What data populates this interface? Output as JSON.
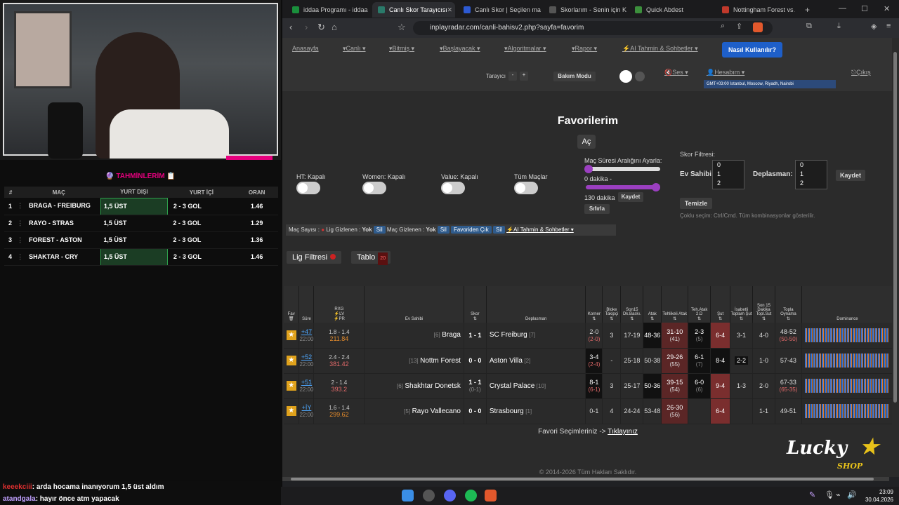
{
  "stream": {
    "predictions_title": "🔮 TAHMİNLERİM 📋",
    "columns": [
      "#",
      "MAÇ",
      "YURT DIŞI",
      "YURT İÇİ",
      "ORAN"
    ],
    "rows": [
      {
        "n": "1",
        "match": "BRAGA - FREIBURG",
        "yurt_disi": "1,5 ÜST",
        "yurt_ici": "2 - 3 GOL",
        "oran": "1.46",
        "highlight": true
      },
      {
        "n": "2",
        "match": "RAYO - STRAS",
        "yurt_disi": "1,5 ÜST",
        "yurt_ici": "2 - 3 GOL",
        "oran": "1.29",
        "highlight": false
      },
      {
        "n": "3",
        "match": "FOREST - ASTON",
        "yurt_disi": "1,5 ÜST",
        "yurt_ici": "2 - 3 GOL",
        "oran": "1.36",
        "highlight": false
      },
      {
        "n": "4",
        "match": "SHAKTAR - CRY",
        "yurt_disi": "1,5 ÜST",
        "yurt_ici": "2 - 3 GOL",
        "oran": "1.46",
        "highlight": true
      }
    ],
    "chat": [
      {
        "user": "keeekciii",
        "msg": ": arda hocama inanıyorum 1,5 üst aldım"
      },
      {
        "user": "atandgala",
        "msg": ": hayır önce atm yapacak"
      }
    ]
  },
  "browser": {
    "tabs": [
      {
        "label": "iddaa Programı - iddaa B",
        "color": "#1a8f3c"
      },
      {
        "label": "Canlı Skor Tarayıcısı",
        "color": "#2a7a6a",
        "active": true
      },
      {
        "label": "Canlı Skor | Seçilen maçl",
        "color": "#2d5ad3"
      },
      {
        "label": "Skorlarım - Senin için Kişi",
        "color": "#222"
      },
      {
        "label": "Quick Abdest",
        "color": "#3c8f3c"
      },
      {
        "label": "Nottingham Forest vs Ast",
        "color": "#c0392b"
      }
    ],
    "url": "inplayradar.com/canli-bahisv2.php?sayfa=favorim"
  },
  "menu": {
    "items": [
      "Anasayfa",
      "▾Canlı ▾",
      "▾Bitmiş ▾",
      "▾Başlayacak ▾",
      "▾Algoritmalar ▾",
      "▾Rapor ▾",
      "⚡AI Tahmin & Sohbetler ▾"
    ],
    "how_button": "Nasıl Kullanılır?",
    "tarayici_label": "Tarayıcı",
    "minus": "-",
    "plus": "+",
    "bakim": "Bakım Modu",
    "ses": "🔇Ses ▾",
    "hesabim": "👤Hesabım ▾",
    "cikis": "⎋Çıkış",
    "timezone": "GMT+03:00 Istanbul, Moscow, Riyadh, Nairobi"
  },
  "filters": {
    "page_title": "Favorilerim",
    "ac_button": "Aç",
    "ht": "HT: Kapalı",
    "women": "Women: Kapalı",
    "value": "Value: Kapalı",
    "tum": "Tüm Maçlar",
    "sure_label": "Maç Süresi Aralığını Ayarla:",
    "min_label": "0 dakika -",
    "max_label": "130 dakika",
    "kaydet": "Kaydet",
    "sifirla": "Sıfırla",
    "skor_filtresi": "Skor Filtresi:",
    "ev_sahibi": "Ev Sahibi:",
    "deplasman": "Deplasman:",
    "score_opts": [
      "0",
      "1",
      "2"
    ],
    "temizle": "Temizle",
    "coklu": "Çoklu seçim: Ctrl/Cmd. Tüm kombinasyonlar gösterilir.",
    "info_mac_sayisi": "Maç Sayısı :",
    "info_lig_gizlenen": "Lig Gizlenen :",
    "info_yok": "Yok",
    "info_sil": "Sil",
    "info_mac_gizlenen": "Maç Gizlenen :",
    "info_favoriden": "Favoriden Çık",
    "info_ai": "⚡AI Tahmin & Sohbetler ▾",
    "lig_filtresi": "Lig Filtresi",
    "tablo": "Tablo",
    "tablo_count": "20"
  },
  "table": {
    "headers": [
      "Fav",
      "Süre",
      "RXG",
      "Ev Sahibi",
      "Skor",
      "Deplasman",
      "Korner",
      "Bloke Takipçi",
      "Son15 Dk.Baskı.",
      "Atak",
      "Tehlikeli Atak",
      "Teh.Atak 2.D",
      "Şut",
      "İsabetli Toplam Şut",
      "Son 15 Dakika Topl.Sut",
      "Topla Oynama",
      "Dominance"
    ],
    "rows": [
      {
        "min": "+47",
        "time": "22:00",
        "rxg": "1.8 - 1.4",
        "val": "211.84",
        "home": "Braga",
        "home_rank": "[6]",
        "score": "1 - 1",
        "ht": "",
        "away": "SC Freiburg",
        "away_rank": "[7]",
        "korner": "2-0",
        "korner2": "(2-0)",
        "bloke": "3",
        "son15": "17-19",
        "atak": "48-36",
        "teh": "31-10",
        "teh2": "(41)",
        "teh2d": "2-3",
        "teh2d2": "(5)",
        "sut": "6-4",
        "isabet": "3-1",
        "son15sut": "4-0",
        "topla": "48-52",
        "topla2": "(50-50)"
      },
      {
        "min": "+52",
        "time": "22:00",
        "rxg": "2.4 - 2.4",
        "val": "381.42",
        "home": "Nottm Forest",
        "home_rank": "[13]",
        "score": "0 - 0",
        "ht": "",
        "away": "Aston Villa",
        "away_rank": "[2]",
        "korner": "3-4",
        "korner2": "(2-4)",
        "bloke": "-",
        "son15": "25-18",
        "atak": "50-38",
        "teh": "29-26",
        "teh2": "(55)",
        "teh2d": "6-1",
        "teh2d2": "(7)",
        "sut": "8-4",
        "isabet": "2-2",
        "son15sut": "1-0",
        "topla": "57-43",
        "topla2": ""
      },
      {
        "min": "+51",
        "time": "22:00",
        "rxg": "2 - 1.4",
        "val": "393.2",
        "home": "Shakhtar Donetsk",
        "home_rank": "[6]",
        "score": "1 - 1",
        "ht": "(0-1)",
        "away": "Crystal Palace",
        "away_rank": "[10]",
        "korner": "8-1",
        "korner2": "(6-1)",
        "bloke": "3",
        "son15": "25-17",
        "atak": "50-36",
        "teh": "39-15",
        "teh2": "(54)",
        "teh2d": "6-0",
        "teh2d2": "(6)",
        "sut": "9-4",
        "isabet": "1-3",
        "son15sut": "2-0",
        "topla": "67-33",
        "topla2": "(65-35)"
      },
      {
        "min": "+İY",
        "time": "22:00",
        "rxg": "1.6 - 1.4",
        "val": "299.62",
        "home": "Rayo Vallecano",
        "home_rank": "[5]",
        "score": "0 - 0",
        "ht": "",
        "away": "Strasbourg",
        "away_rank": "[1]",
        "korner": "0-1",
        "korner2": "",
        "bloke": "4",
        "son15": "24-24",
        "atak": "53-48",
        "teh": "26-30",
        "teh2": "(56)",
        "teh2d": "",
        "teh2d2": "",
        "sut": "6-4",
        "isabet": "",
        "son15sut": "1-1",
        "topla": "49-51",
        "topla2": ""
      }
    ],
    "footer_text": "Favori Seçimleriniz -> ",
    "footer_link": "Tıklayınız",
    "copyright": "© 2014-2026 Tüm Hakları Saklıdır."
  },
  "overlay": {
    "brand": "Lucky",
    "shop": "SHOP"
  },
  "clock": {
    "time": "23:09",
    "date": "30.04.2026"
  }
}
